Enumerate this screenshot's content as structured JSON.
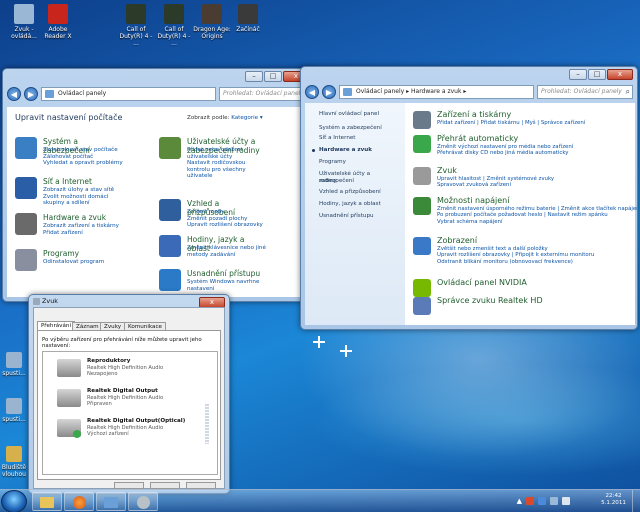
{
  "desktop": {
    "icons": [
      {
        "label": "Zvuk - ovládá...",
        "color": "#9bb7d6"
      },
      {
        "label": "Adobe Reader X",
        "color": "#c8261c"
      },
      {
        "label": "Call of Duty(R) 4 - ...",
        "color": "#2c3a2a"
      },
      {
        "label": "Call of Duty(R) 4 - ...",
        "color": "#2c3a2a"
      },
      {
        "label": "Dragon Age: Origins",
        "color": "#4a3c30"
      },
      {
        "label": "Začínáč",
        "color": "#3a3a3a"
      }
    ],
    "side_icons": [
      {
        "label": "spusti...",
        "color": "#9ab4d0"
      },
      {
        "label": "spusti...",
        "color": "#9ab4d0"
      },
      {
        "label": "Bludiště\nvlouhou",
        "color": "#d6b04a"
      }
    ]
  },
  "cp_window": {
    "address": "Ovládací panely",
    "search_placeholder": "Prohledat: Ovládací panely",
    "heading": "Upravit nastavení počítače",
    "view_label": "Zobrazit podle:",
    "view_value": "Kategorie",
    "categories": [
      {
        "title": "Systém a zabezpečení",
        "icon_color": "#3a7fc4",
        "links": [
          "Zkontrolovat stav počítače",
          "Zálohovat počítač",
          "Vyhledat a opravit problémy"
        ]
      },
      {
        "title": "Síť a Internet",
        "icon_color": "#2a5fa8",
        "links": [
          "Zobrazit úlohy a stav sítě",
          "Zvolit možnosti domácí",
          "skupiny a sdílení"
        ]
      },
      {
        "title": "Hardware a zvuk",
        "icon_color": "#6a6a6a",
        "links": [
          "Zobrazit zařízení a tiskárny",
          "Přidat zařízení"
        ]
      },
      {
        "title": "Programy",
        "icon_color": "#8a8fa0",
        "links": [
          "Odinstalovat program"
        ]
      },
      {
        "title": "Uživatelské účty a zabezpečení rodiny",
        "icon_color": "#5a8a3a",
        "links": [
          "Přidat nebo odebrat",
          "uživatelské účty",
          "Nastavit rodičovskou",
          "kontrolu pro všechny",
          "uživatele"
        ]
      },
      {
        "title": "Vzhled a přizpůsobení",
        "icon_color": "#2f5f9c",
        "links": [
          "Změnit motiv",
          "Změnit pozadí plochy",
          "Upravit rozlišení obrazovky"
        ]
      },
      {
        "title": "Hodiny, jazyk a oblast",
        "icon_color": "#3a6ab8",
        "links": [
          "Změnit klávesnice nebo jiné",
          "metody zadávání"
        ]
      },
      {
        "title": "Usnadnění přístupu",
        "icon_color": "#2a7ac8",
        "links": [
          "Systém Windows navrhne",
          "nastavení"
        ]
      }
    ]
  },
  "hw_window": {
    "address": "Ovládací panely ▸ Hardware a zvuk ▸",
    "search_placeholder": "Prohledat: Ovládací panely",
    "sidebar": [
      "Hlavní ovládací panel",
      "Systém a zabezpečení",
      "Síť a Internet",
      "Hardware a zvuk",
      "Programy",
      "Uživatelské účty a zabezpečení",
      "rodiny",
      "Vzhled a přizpůsobení",
      "Hodiny, jazyk a oblast",
      "Usnadnění přístupu"
    ],
    "sections": [
      {
        "title": "Zařízení a tiskárny",
        "icon_color": "#6b7a8a",
        "links": [
          "Přidat zařízení  |  Přidat tiskárnu  |  Myš  |  Správce zařízení"
        ]
      },
      {
        "title": "Přehrát automaticky",
        "icon_color": "#3aa84a",
        "links": [
          "Změnit výchozí nastavení pro média nebo zařízení",
          "Přehrávat disky CD nebo jiná média automaticky"
        ]
      },
      {
        "title": "Zvuk",
        "icon_color": "#9a9a9a",
        "links": [
          "Upravit hlasitost  |  Změnit systémové zvuky",
          "Spravovat zvuková zařízení"
        ]
      },
      {
        "title": "Možnosti napájení",
        "icon_color": "#3a8a3a",
        "links": [
          "Změnit nastavení úsporného režimu baterie  |  Změnit akce tlačítek napájení",
          "Po probuzení počítače požadovat heslo  |  Nastavit režim spánku",
          "Vybrat schéma napájení"
        ]
      },
      {
        "title": "Zobrazení",
        "icon_color": "#3a78c8",
        "links": [
          "Zvětšit nebo zmenšit text a další položky",
          "Upravit rozlišení obrazovky  |  Připojit k externímu monitoru",
          "Odstranit blikání monitoru (obnovovací frekvence)"
        ]
      },
      {
        "title": "Ovládací panel NVIDIA",
        "icon_color": "#76b900",
        "links": []
      },
      {
        "title": "Správce zvuku Realtek HD",
        "icon_color": "#5a7ab8",
        "links": []
      }
    ]
  },
  "sound_dialog": {
    "title": "Zvuk",
    "tabs": [
      "Přehrávání",
      "Záznam",
      "Zvuky",
      "Komunikace"
    ],
    "instruction": "Po výběru zařízení pro přehrávání níže můžete upravit jeho nastavení:",
    "devices": [
      {
        "name": "Reproduktory",
        "line1": "Realtek High Definition Audio",
        "line2": "Nezapojeno"
      },
      {
        "name": "Realtek Digital Output",
        "line1": "Realtek High Definition Audio",
        "line2": "Připraven"
      },
      {
        "name": "Realtek Digital Output(Optical)",
        "line1": "Realtek High Definition Audio",
        "line2": "Výchozí zařízení"
      }
    ]
  },
  "taskbar": {
    "time": "22:42",
    "date": "5.1.2011"
  }
}
